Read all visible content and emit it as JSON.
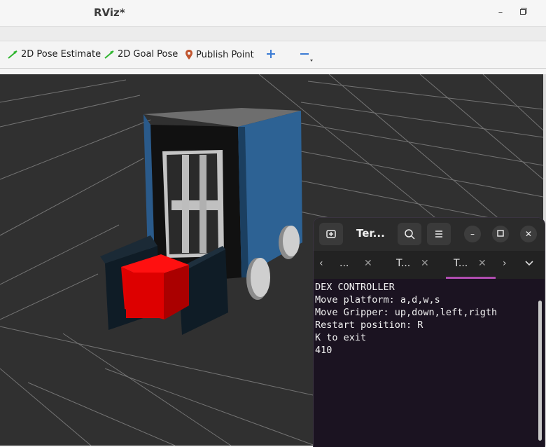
{
  "window": {
    "title": "RViz*",
    "min_icon": "minimize-icon",
    "max_icon": "maximize-icon"
  },
  "toolbar": {
    "pose_estimate_label": "2D Pose Estimate",
    "goal_pose_label": "2D Goal Pose",
    "publish_point_label": "Publish Point",
    "add_icon": "plus-icon",
    "remove_icon": "minus-icon"
  },
  "terminal": {
    "title": "Ter...",
    "tabs": [
      {
        "label": "..."
      },
      {
        "label": "T..."
      },
      {
        "label": "T..."
      }
    ],
    "lines": [
      "DEX CONTROLLER",
      "Move platform: a,d,w,s",
      "Move Gripper: up,down,left,rigth",
      "Restart position: R",
      "K to exit",
      "410"
    ],
    "accent": "#b04db0"
  }
}
